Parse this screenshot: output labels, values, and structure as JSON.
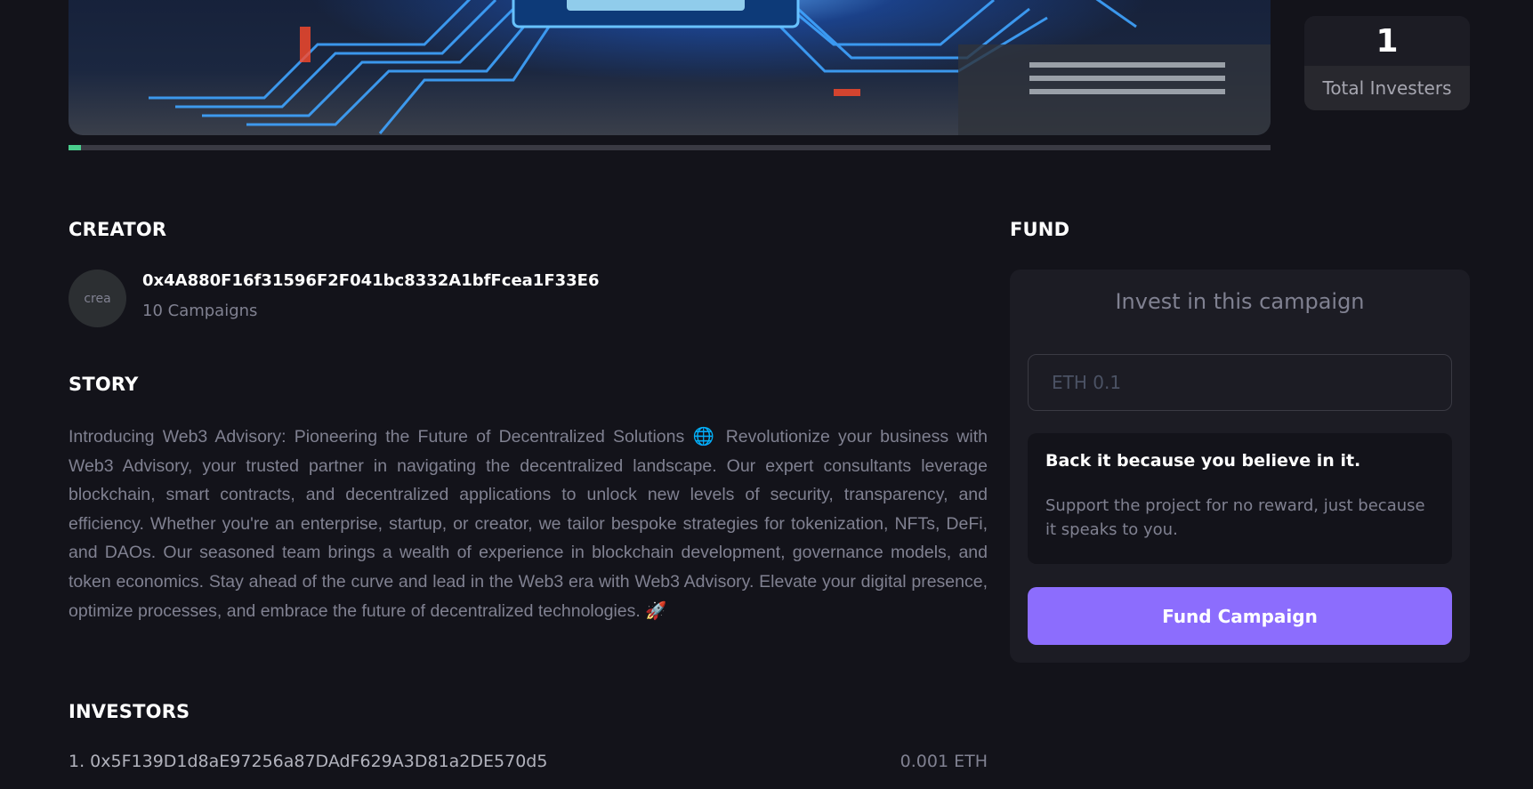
{
  "campaign": {
    "progress_percent": 1
  },
  "stats": {
    "total_investors_value": "1",
    "total_investors_label": "Total Investers"
  },
  "creator": {
    "heading": "CREATOR",
    "address": "0x4A880F16f31596F2F041bc8332A1bfFcea1F33E6",
    "campaigns": "10 Campaigns",
    "avatar_alt": "crea"
  },
  "story": {
    "heading": "STORY",
    "text": "Introducing Web3 Advisory: Pioneering the Future of Decentralized Solutions 🌐 Revolutionize your business with Web3 Advisory, your trusted partner in navigating the decentralized landscape. Our expert consultants leverage blockchain, smart contracts, and decentralized applications to unlock new levels of security, transparency, and efficiency. Whether you're an enterprise, startup, or creator, we tailor bespoke strategies for tokenization, NFTs, DeFi, and DAOs. Our seasoned team brings a wealth of experience in blockchain development, governance models, and token economics. Stay ahead of the curve and lead in the Web3 era with Web3 Advisory. Elevate your digital presence, optimize processes, and embrace the future of decentralized technologies. 🚀"
  },
  "investors": {
    "heading": "INVESTORS",
    "items": [
      {
        "label": "1. 0x5F139D1d8aE97256a87DAdF629A3D81a2DE570d5",
        "amount": "0.001 ETH"
      }
    ]
  },
  "fund": {
    "heading": "FUND",
    "title": "Invest in this campaign",
    "input_placeholder": "ETH 0.1",
    "pledge_title": "Back it because you believe in it.",
    "pledge_text": "Support the project for no reward, just because it speaks to you.",
    "button_label": "Fund Campaign"
  },
  "colors": {
    "accent": "#8c6dfd",
    "progress": "#4acd8d",
    "background": "#13131a",
    "card": "#1c1c24"
  }
}
